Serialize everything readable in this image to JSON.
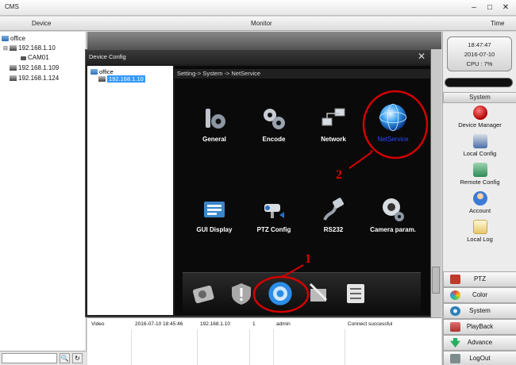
{
  "window": {
    "title": "CMS"
  },
  "menubar": {
    "device": "Device",
    "monitor": "Monitor",
    "time": "Time"
  },
  "tree": {
    "root": "office",
    "devices": [
      {
        "label": "192.168.1.10",
        "expanded": true
      },
      {
        "label": "CAM01",
        "child": true
      },
      {
        "label": "192.168.1.109"
      },
      {
        "label": "192.168.1.124"
      }
    ]
  },
  "clock": {
    "time": "18:47:47",
    "date": "2016-07-10",
    "cpu": "CPU : 7%"
  },
  "right_panel": {
    "system_header": "System",
    "items": [
      {
        "label": "Device Manager",
        "icon": "device-manager-icon",
        "color": "#d61f1f"
      },
      {
        "label": "Local Config",
        "icon": "local-config-icon",
        "color": "#4b6fa8"
      },
      {
        "label": "Remote Config",
        "icon": "remote-config-icon",
        "color": "#2e8b57"
      },
      {
        "label": "Account",
        "icon": "account-icon",
        "color": "#3a7bd5"
      },
      {
        "label": "Local Log",
        "icon": "local-log-icon",
        "color": "#e6c66b"
      }
    ],
    "nav": [
      {
        "label": "PTZ",
        "icon": "ptz-icon",
        "color": "#c0392b"
      },
      {
        "label": "Color",
        "icon": "color-icon",
        "color": "#e74c3c"
      },
      {
        "label": "System",
        "icon": "system-icon",
        "color": "#2980b9"
      },
      {
        "label": "PlayBack",
        "icon": "playback-icon",
        "color": "#b03030"
      },
      {
        "label": "Advance",
        "icon": "advance-icon",
        "color": "#27ae60"
      },
      {
        "label": "LogOut",
        "icon": "logout-icon",
        "color": "#7f8c8d"
      }
    ]
  },
  "log": {
    "row": {
      "type": "Video",
      "time": "2016-07-10 18:45:46",
      "ip": "192.168.1.10",
      "channel": "1",
      "user": "admin",
      "result": "Connect successful"
    }
  },
  "dialog": {
    "title": "Device Config",
    "tree_root": "office",
    "tree_device": "192.168.1.10",
    "breadcrumb": "Setting-> System -> NetService",
    "tiles": [
      {
        "label": "General",
        "icon": "general-wrench-gear-icon"
      },
      {
        "label": "Encode",
        "icon": "encode-gears-icon"
      },
      {
        "label": "Network",
        "icon": "network-computers-icon"
      },
      {
        "label": "NetService",
        "icon": "netservice-globe-icon"
      },
      {
        "label": "GUI Display",
        "icon": "gui-display-icon"
      },
      {
        "label": "PTZ Config",
        "icon": "ptz-config-camera-icon"
      },
      {
        "label": "RS232",
        "icon": "rs232-cable-icon"
      },
      {
        "label": "Camera param.",
        "icon": "camera-param-icon"
      }
    ],
    "dock": [
      "hdd-icon",
      "alarm-shield-icon",
      "system-gear-icon",
      "tools-icon",
      "info-list-icon"
    ]
  },
  "annotations": {
    "step1": "1",
    "step2": "2",
    "color": "#d40000"
  }
}
